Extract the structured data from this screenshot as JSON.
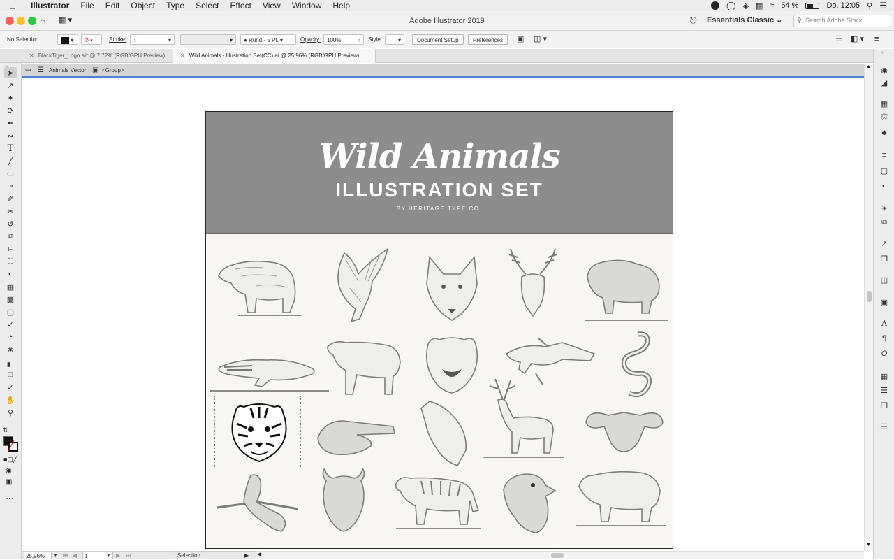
{
  "menubar": {
    "app_name": "Illustrator",
    "items": [
      "File",
      "Edit",
      "Object",
      "Type",
      "Select",
      "Effect",
      "View",
      "Window",
      "Help"
    ],
    "battery": "54 %",
    "clock": "Do. 12:05"
  },
  "window": {
    "title": "Adobe Illustrator 2019",
    "workspace": "Essentials Classic",
    "stock_search_placeholder": "Search Adobe Stock"
  },
  "control_bar": {
    "selection": "No Selection",
    "stroke_label": "Stroke:",
    "brush": "Rund - 5 Pt.",
    "opacity_label": "Opacity:",
    "opacity_value": "100%",
    "style_label": "Style:",
    "document_setup": "Document Setup",
    "preferences": "Preferences"
  },
  "tabs": [
    {
      "label": "BlackTiger_Logo.ai* @ 7,72% (RGB/GPU Preview)",
      "active": false
    },
    {
      "label": "Wild Animals - Illustration Set(CC).ai @ 25,96% (RGB/GPU Preview)",
      "active": true
    }
  ],
  "breadcrumb": {
    "layer": "Animals Vector",
    "group": "<Group>"
  },
  "artboard": {
    "title": "Wild Animals",
    "subtitle": "ILLUSTRATION SET",
    "byline": "BY HERITAGE TYPE CO."
  },
  "status": {
    "zoom": "25,96%",
    "artboard_num": "1",
    "tool": "Selection"
  },
  "colors": {
    "accent": "#4f83d6",
    "banner": "#8c8c8c",
    "sketch": "#8a8a8a",
    "selected_art": "#111111"
  },
  "icons": {
    "tools": [
      "selection-tool-icon",
      "direct-selection-tool-icon",
      "magic-wand-icon",
      "lasso-icon",
      "pen-tool-icon",
      "curvature-tool-icon",
      "type-tool-icon",
      "line-tool-icon",
      "rectangle-tool-icon",
      "paintbrush-icon",
      "shaper-tool-icon",
      "scissors-icon",
      "rotate-tool-icon",
      "scale-tool-icon",
      "width-tool-icon",
      "free-transform-icon",
      "shape-builder-icon",
      "perspective-grid-icon",
      "mesh-tool-icon",
      "gradient-tool-icon",
      "eyedropper-icon",
      "blend-tool-icon",
      "symbol-sprayer-icon",
      "graph-tool-icon",
      "artboard-tool-icon",
      "slice-tool-icon",
      "hand-tool-icon",
      "zoom-tool-icon"
    ],
    "panels": [
      "color-panel-icon",
      "color-guide-icon",
      "swatches-icon",
      "brushes-icon",
      "symbols-icon",
      "stroke-panel-icon",
      "gradient-panel-icon",
      "transparency-icon",
      "appearance-icon",
      "graphic-styles-icon",
      "export-icon",
      "asset-export-icon",
      "libraries-icon",
      "properties-icon",
      "character-icon",
      "paragraph-icon",
      "opentype-icon",
      "transform-icon",
      "align-icon",
      "pathfinder-icon",
      "layers-icon"
    ]
  }
}
